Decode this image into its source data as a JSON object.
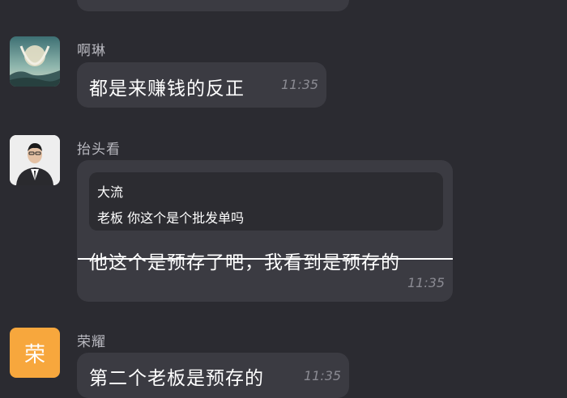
{
  "messages": [
    {
      "sender": "啊琳",
      "avatar_icon": "moon-landscape-avatar-icon",
      "text": "都是来赚钱的反正",
      "time": "11:35"
    },
    {
      "sender": "抬头看",
      "avatar_icon": "man-in-suit-avatar-icon",
      "quote": {
        "author": "大流",
        "text": "老板 你这个是个批发单吗"
      },
      "text": "他这个是预存了吧，我看到是预存的",
      "strikethrough": true,
      "time": "11:35"
    },
    {
      "sender": "荣耀",
      "avatar_text": "荣",
      "avatar_color": "#f7a73d",
      "text": "第二个老板是预存的",
      "time": "11:35"
    }
  ]
}
